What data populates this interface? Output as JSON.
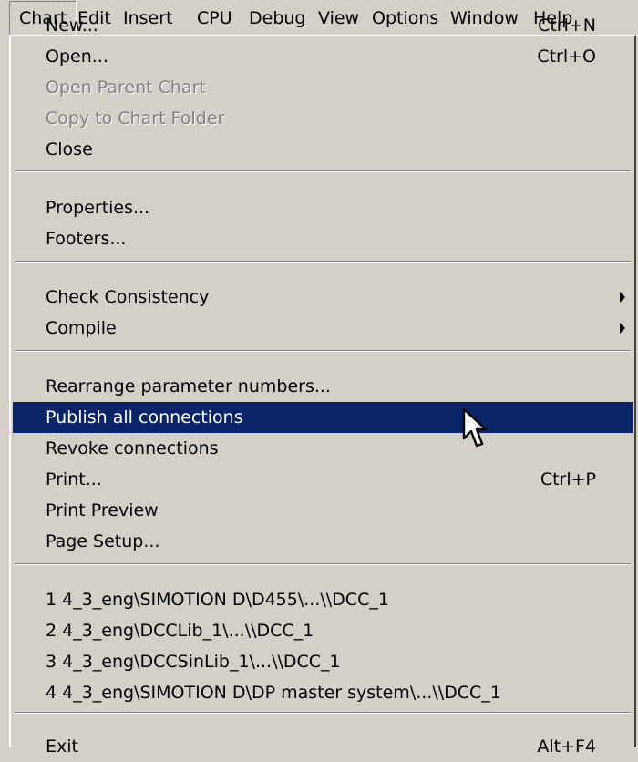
{
  "menubar": {
    "items": [
      {
        "label": "Chart"
      },
      {
        "label": "Edit"
      },
      {
        "label": "Insert"
      },
      {
        "label": "CPU"
      },
      {
        "label": "Debug"
      },
      {
        "label": "View"
      },
      {
        "label": "Options"
      },
      {
        "label": "Window"
      },
      {
        "label": "Help"
      }
    ],
    "active_index": 0
  },
  "chart_menu": {
    "groups": [
      [
        {
          "label": "New...",
          "shortcut": "Ctrl+N",
          "enabled": true
        },
        {
          "label": "Open...",
          "shortcut": "Ctrl+O",
          "enabled": true
        },
        {
          "label": "Open Parent Chart",
          "enabled": false
        },
        {
          "label": "Copy to Chart Folder",
          "enabled": false
        },
        {
          "label": "Close",
          "enabled": true
        }
      ],
      [
        {
          "label": "Properties...",
          "enabled": true
        },
        {
          "label": "Footers...",
          "enabled": true
        }
      ],
      [
        {
          "label": "Check Consistency",
          "enabled": true,
          "submenu": true
        },
        {
          "label": "Compile",
          "enabled": true,
          "submenu": true
        }
      ],
      [
        {
          "label": "Rearrange parameter numbers...",
          "enabled": true
        },
        {
          "label": "Publish all connections",
          "enabled": true,
          "highlighted": true
        },
        {
          "label": "Revoke connections",
          "enabled": true
        },
        {
          "label": "Print...",
          "shortcut": "Ctrl+P",
          "enabled": true
        },
        {
          "label": "Print Preview",
          "enabled": true
        },
        {
          "label": "Page Setup...",
          "enabled": true
        }
      ],
      [
        {
          "label": "1 4_3_eng\\SIMOTION D\\D455\\...\\\\DCC_1",
          "enabled": true
        },
        {
          "label": "2 4_3_eng\\DCCLib_1\\...\\\\DCC_1",
          "enabled": true
        },
        {
          "label": "3 4_3_eng\\DCCSinLib_1\\...\\\\DCC_1",
          "enabled": true
        },
        {
          "label": "4 4_3_eng\\SIMOTION D\\DP master system\\...\\\\DCC_1",
          "enabled": true
        }
      ],
      [
        {
          "label": "Exit",
          "shortcut": "Alt+F4",
          "enabled": true
        }
      ]
    ]
  },
  "colors": {
    "menu_face": "#d4d0c8",
    "highlight": "#0a246a",
    "disabled_text": "#808080"
  },
  "icons": {
    "submenu_arrow": "submenu-arrow-icon",
    "cursor": "mouse-pointer-icon"
  }
}
